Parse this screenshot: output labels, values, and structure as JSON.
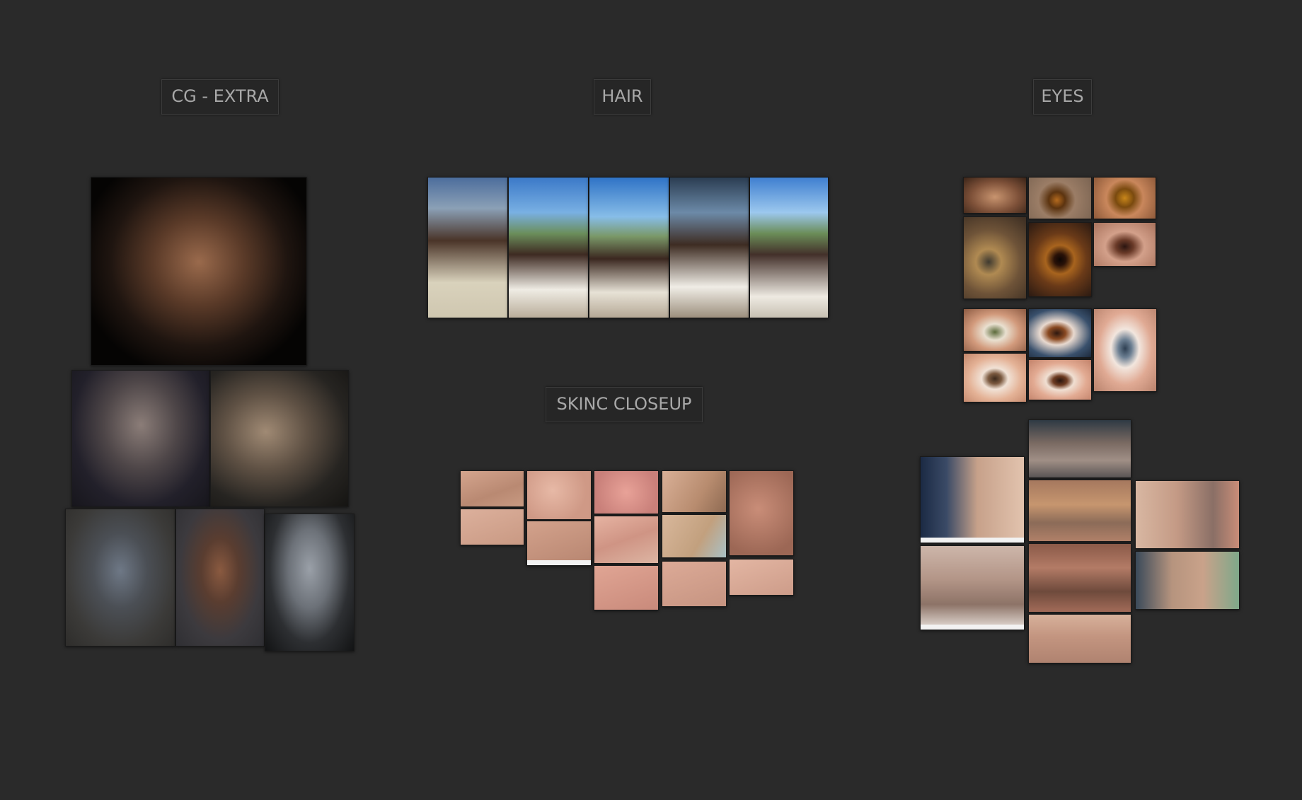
{
  "board": {
    "background": "#2a2a2a"
  },
  "groups": {
    "cg_extra": {
      "label": "CG - EXTRA"
    },
    "hair": {
      "label": "HAIR"
    },
    "eyes": {
      "label": "EYES"
    },
    "skin": {
      "label": "SKINC CLOSEUP"
    }
  },
  "images": {
    "cg_extra": [
      "dark-portrait",
      "portrait-a",
      "portrait-b",
      "statue-a",
      "statue-b",
      "head-sculpt"
    ],
    "hair": [
      "back-view",
      "front-view-1",
      "front-view-2",
      "side-view-1",
      "side-view-2"
    ],
    "skin": [
      "skin-1",
      "skin-2",
      "skin-3",
      "skin-4",
      "skin-5",
      "skin-6",
      "skin-7",
      "skin-8",
      "skin-9",
      "skin-10",
      "skin-11",
      "skin-12"
    ],
    "eyes": [
      "eye-1",
      "eye-2",
      "eye-3",
      "eye-4",
      "eye-5",
      "eye-6",
      "eye-7",
      "eye-8",
      "eye-9",
      "eye-10",
      "eye-11",
      "old-1",
      "old-2",
      "old-3",
      "old-4",
      "old-5",
      "old-6",
      "old-7",
      "old-8"
    ]
  }
}
